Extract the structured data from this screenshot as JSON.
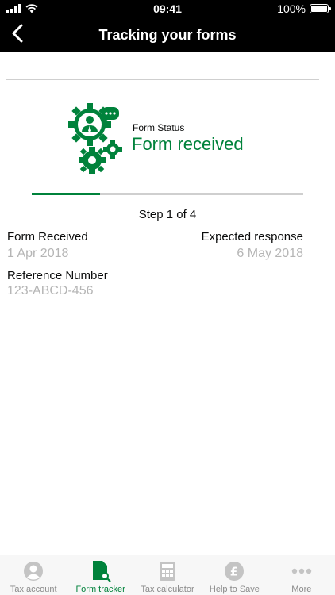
{
  "status_bar": {
    "time": "09:41",
    "battery": "100%"
  },
  "nav": {
    "title": "Tracking your forms"
  },
  "form_status": {
    "label": "Form Status",
    "value": "Form received"
  },
  "progress": {
    "fraction": 0.25,
    "step_text": "Step 1 of 4"
  },
  "details": {
    "received_label": "Form Received",
    "received_value": "1 Apr 2018",
    "expected_label": "Expected response",
    "expected_value": "6 May 2018",
    "reference_label": "Reference Number",
    "reference_value": "123-ABCD-456"
  },
  "tabs": [
    {
      "label": "Tax account",
      "icon": "person-icon",
      "active": false
    },
    {
      "label": "Form tracker",
      "icon": "form-tracker-icon",
      "active": true
    },
    {
      "label": "Tax calculator",
      "icon": "calculator-icon",
      "active": false
    },
    {
      "label": "Help to Save",
      "icon": "pound-coin-icon",
      "active": false
    },
    {
      "label": "More",
      "icon": "more-icon",
      "active": false
    }
  ],
  "colors": {
    "accent": "#00823b",
    "muted_text": "#b5b5b5",
    "header_bg": "#000000"
  }
}
